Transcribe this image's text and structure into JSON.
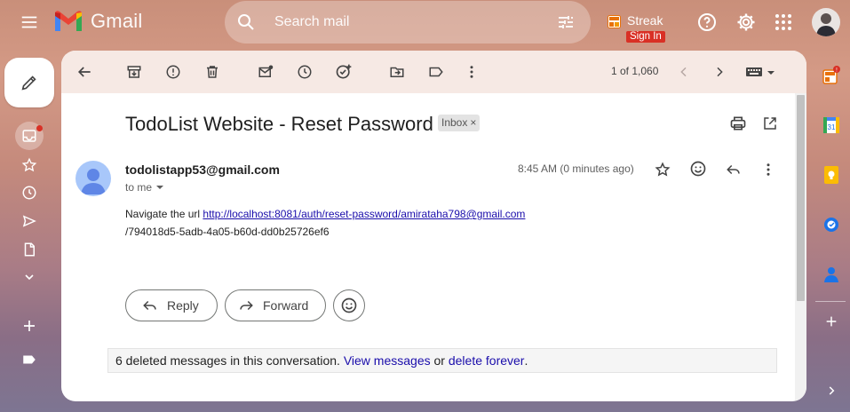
{
  "app": {
    "name": "Gmail"
  },
  "search": {
    "placeholder": "Search mail"
  },
  "streak": {
    "name": "Streak",
    "signin": "Sign In"
  },
  "toolbar": {
    "pager": "1 of 1,060"
  },
  "message": {
    "subject": "TodoList Website - Reset Password",
    "label": "Inbox",
    "label_close": "×",
    "sender": "todolistapp53@gmail.com",
    "recipient": "to me",
    "time": "8:45 AM (0 minutes ago)",
    "body_text": "Navigate the url ",
    "link": "http://localhost:8081/auth/reset-password/amirataha798@gmail.com",
    "link_cont": "/794018d5-5adb-4a05-b60d-dd0b25726ef6"
  },
  "actions": {
    "reply": "Reply",
    "forward": "Forward"
  },
  "deleted": {
    "text": "6 deleted messages in this conversation.",
    "view": "View messages",
    "or": "or",
    "delete": "delete forever",
    "end": "."
  },
  "icons": [
    "menu-icon",
    "gmail-logo",
    "search-icon",
    "tune-icon",
    "help-icon",
    "gear-icon",
    "apps-icon",
    "pencil-icon",
    "inbox-icon",
    "star-icon",
    "clock-icon",
    "send-icon",
    "draft-icon",
    "chevron-down-icon",
    "plus-icon",
    "label-icon",
    "back-arrow-icon",
    "archive-icon",
    "report-icon",
    "trash-icon",
    "mark-unread-icon",
    "snooze-icon",
    "add-task-icon",
    "move-to-icon",
    "label-icon",
    "more-icon",
    "chevron-left-icon",
    "chevron-right-icon",
    "keyboard-icon",
    "print-icon",
    "open-new-icon",
    "reply-icon",
    "forward-icon",
    "emoji-icon",
    "calendar-icon",
    "keep-icon",
    "tasks-icon",
    "contacts-icon"
  ],
  "colors": {
    "accent_red": "#d93025",
    "link": "#1a0dab",
    "toolbar_bg": "#f6e9e4"
  }
}
